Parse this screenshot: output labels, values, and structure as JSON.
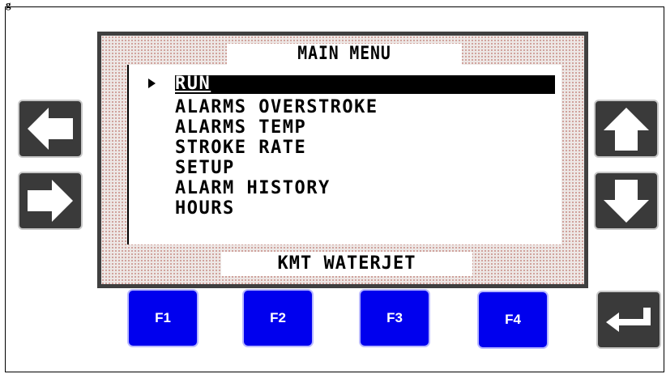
{
  "caption": "g",
  "screen": {
    "title": "MAIN MENU",
    "footer": "KMT WATERJET",
    "menu_items": [
      "RUN",
      "ALARMS OVERSTROKE",
      "ALARMS TEMP",
      "STROKE RATE",
      "SETUP",
      "ALARM HISTORY",
      "HOURS"
    ],
    "selected_index": 0
  },
  "nav_buttons": {
    "left": "left-arrow-icon",
    "right": "right-arrow-icon",
    "up": "up-arrow-icon",
    "down": "down-arrow-icon",
    "enter": "enter-icon"
  },
  "function_keys": [
    "F1",
    "F2",
    "F3",
    "F4"
  ],
  "colors": {
    "function_key": "#0000ee",
    "nav_button": "#3a3a3a",
    "screen_dots": "#c9918a",
    "bezel": "#3f3f3f"
  }
}
